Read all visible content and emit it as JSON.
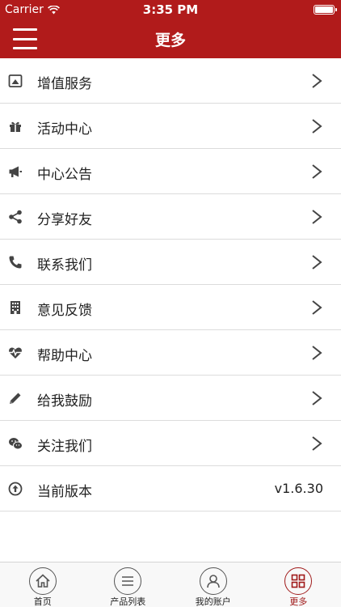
{
  "status_bar": {
    "carrier": "Carrier",
    "time": "3:35 PM"
  },
  "nav": {
    "title": "更多"
  },
  "menu": {
    "items": [
      {
        "label": "增值服务",
        "icon": "image-icon"
      },
      {
        "label": "活动中心",
        "icon": "gift-icon"
      },
      {
        "label": "中心公告",
        "icon": "megaphone-icon"
      },
      {
        "label": "分享好友",
        "icon": "share-icon"
      },
      {
        "label": "联系我们",
        "icon": "phone-icon"
      },
      {
        "label": "意见反馈",
        "icon": "building-icon"
      },
      {
        "label": "帮助中心",
        "icon": "heartbeat-icon"
      },
      {
        "label": "给我鼓励",
        "icon": "pencil-icon"
      },
      {
        "label": "关注我们",
        "icon": "wechat-icon"
      }
    ],
    "version_label": "当前版本",
    "version_value": "v1.6.30",
    "version_icon": "upload-circle-icon"
  },
  "tabs": [
    {
      "label": "首页",
      "icon": "home-icon"
    },
    {
      "label": "产品列表",
      "icon": "list-icon"
    },
    {
      "label": "我的账户",
      "icon": "user-icon"
    },
    {
      "label": "更多",
      "icon": "grid-icon"
    }
  ],
  "colors": {
    "brand": "#b11b1b",
    "active_tab": "#a01a1a"
  }
}
